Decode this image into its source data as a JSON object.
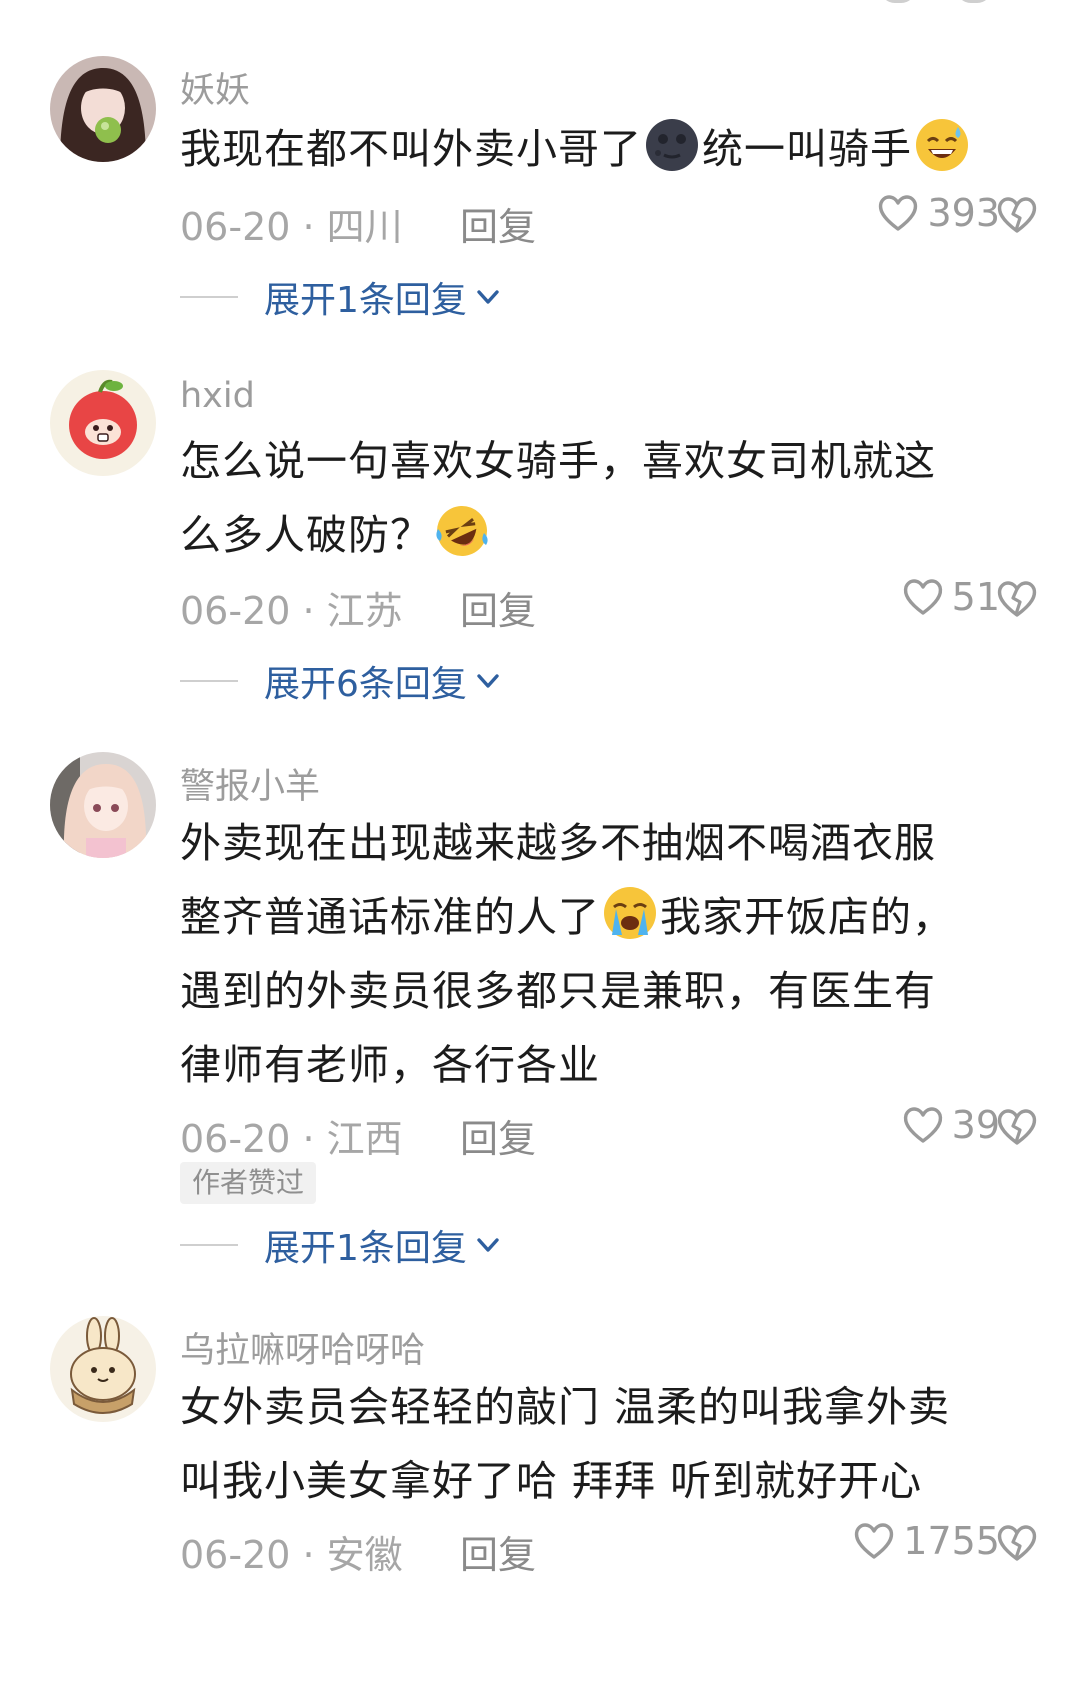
{
  "comments": [
    {
      "username": "妖妖",
      "lines": [
        {
          "parts": [
            "我现在都不叫外卖小哥了",
            "统一叫骑手"
          ]
        }
      ],
      "emojis": [
        "dark-moon-face-emoji",
        "grinning-sweat-emoji"
      ],
      "date": "06-20 · 四川",
      "reply_label": "回复",
      "likes": "393",
      "expand_label": "展开1条回复"
    },
    {
      "username": "hxid",
      "lines": [
        {
          "text": "怎么说一句喜欢女骑手，喜欢女司机就这"
        },
        {
          "text": "么多人破防？"
        }
      ],
      "emojis": [
        "rolling-laughing-emoji"
      ],
      "date": "06-20 · 江苏",
      "reply_label": "回复",
      "likes": "51",
      "expand_label": "展开6条回复"
    },
    {
      "username": "警报小羊",
      "lines": [
        {
          "text": "外卖现在出现越来越多不抽烟不喝酒衣服"
        },
        {
          "parts": [
            "整齐普通话标准的人了",
            "我家开饭店的，"
          ]
        },
        {
          "text": "遇到的外卖员很多都只是兼职，有医生有"
        },
        {
          "text": "律师有老师，各行各业"
        }
      ],
      "emojis": [
        "crying-face-emoji"
      ],
      "date": "06-20 · 江西",
      "reply_label": "回复",
      "likes": "39",
      "badge": "作者赞过",
      "expand_label": "展开1条回复"
    },
    {
      "username": "乌拉嘛呀哈呀哈",
      "lines": [
        {
          "text": "女外卖员会轻轻的敲门 温柔的叫我拿外卖"
        },
        {
          "text": "叫我小美女拿好了哈 拜拜 听到就好开心"
        }
      ],
      "date": "06-20 · 安徽",
      "reply_label": "回复",
      "likes": "1755"
    }
  ],
  "icons": {
    "like": "heart-outline-icon",
    "dislike": "broken-heart-icon",
    "expand": "chevron-down-icon"
  },
  "colors": {
    "username": "#9c9c9c",
    "text": "#1c1c1c",
    "meta": "#a6a6a6",
    "expand_link": "#2e5f9f"
  }
}
